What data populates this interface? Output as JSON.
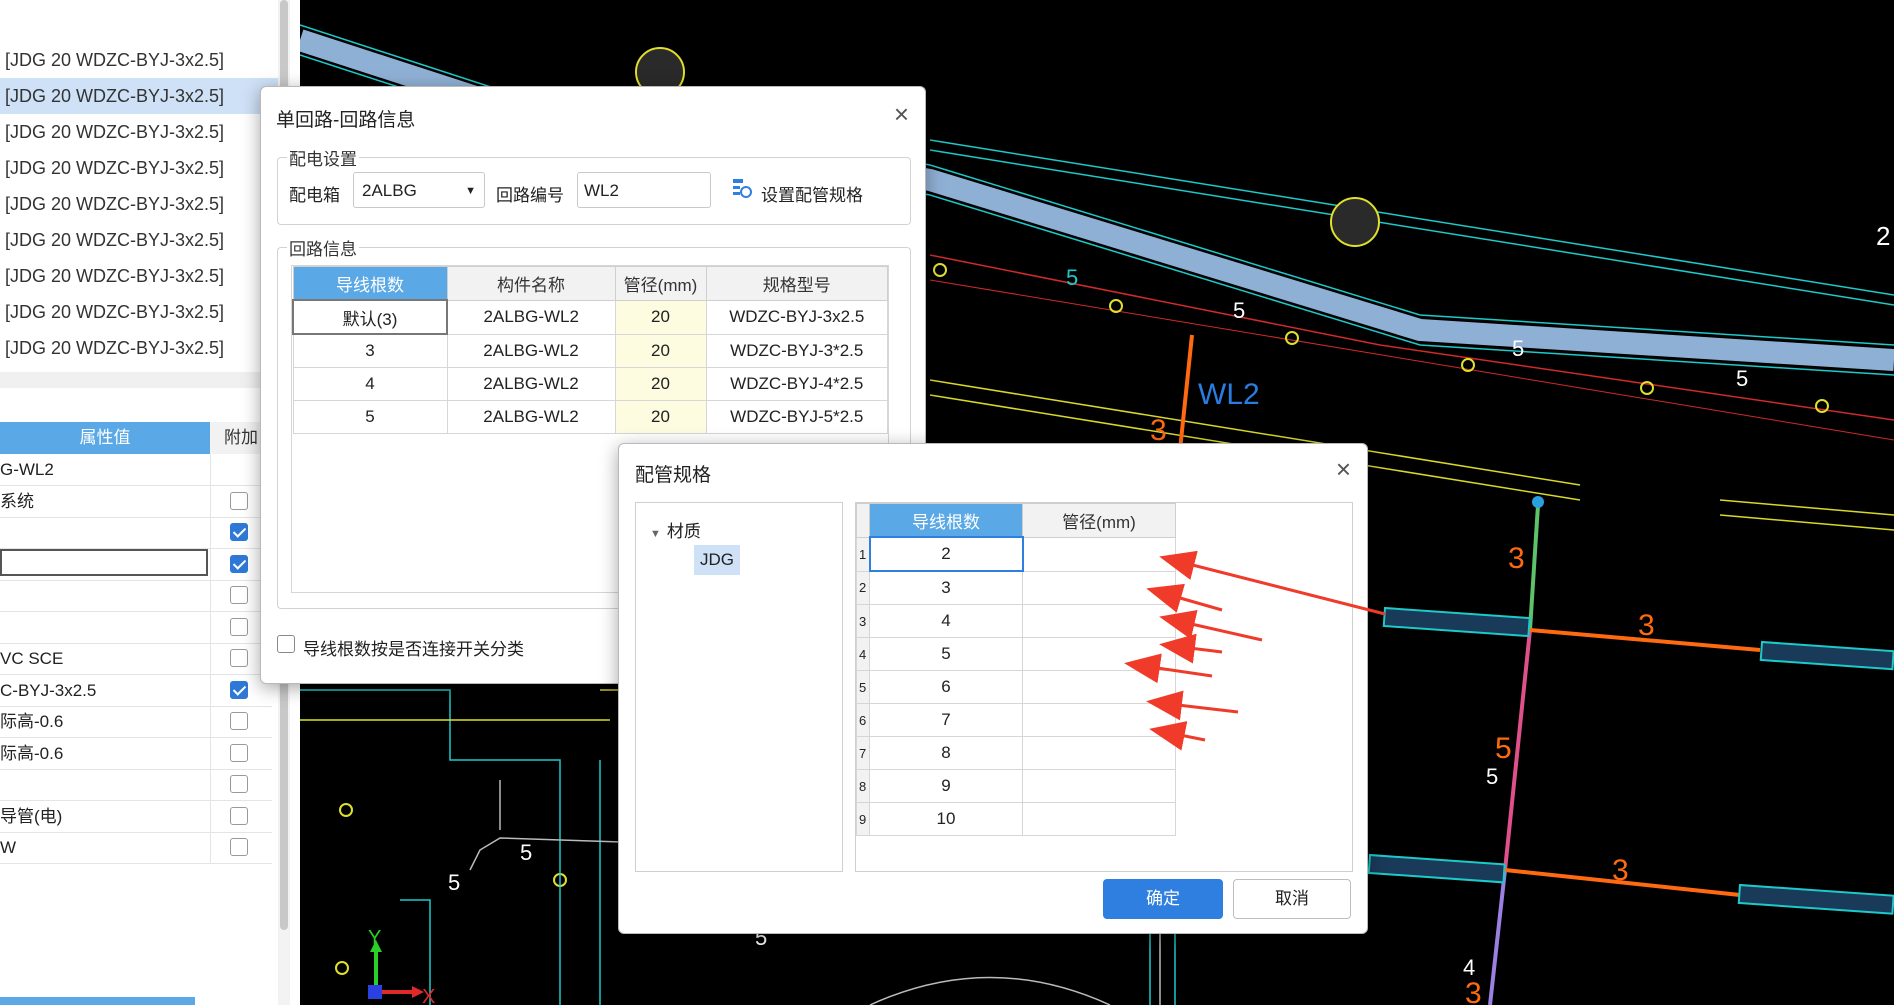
{
  "left_list": {
    "items": [
      "[JDG 20 WDZC-BYJ-3x2.5]",
      "[JDG 20 WDZC-BYJ-3x2.5]",
      "[JDG 20 WDZC-BYJ-3x2.5]",
      "[JDG 20 WDZC-BYJ-3x2.5]",
      "[JDG 20 WDZC-BYJ-3x2.5]",
      "[JDG 20 WDZC-BYJ-3x2.5]",
      "[JDG 20 WDZC-BYJ-3x2.5]",
      "[JDG 20 WDZC-BYJ-3x2.5]",
      "[JDG 20 WDZC-BYJ-3x2.5]"
    ],
    "selected_index": 1
  },
  "props": {
    "header_value": "属性值",
    "header_extra": "附加",
    "rows": [
      {
        "value": "G-WL2",
        "check": null
      },
      {
        "value": "系统",
        "check": false
      },
      {
        "value": "",
        "check": true
      },
      {
        "value": "",
        "check": true
      },
      {
        "value": "",
        "check": false
      },
      {
        "value": "",
        "check": false
      },
      {
        "value": "VC SCE",
        "check": false
      },
      {
        "value": "C-BYJ-3x2.5",
        "check": true
      },
      {
        "value": "际高-0.6",
        "check": false
      },
      {
        "value": "际高-0.6",
        "check": false
      },
      {
        "value": "",
        "check": false
      },
      {
        "value": "导管(电)",
        "check": false
      },
      {
        "value": "W",
        "check": false
      }
    ]
  },
  "circuit_dialog": {
    "title": "单回路-回路信息",
    "close": "×",
    "distribution_group": "配电设置",
    "box_label": "配电箱",
    "box_value": "2ALBG",
    "circuit_no_label": "回路编号",
    "circuit_no_value": "WL2",
    "set_spec_label": "设置配管规格",
    "circuit_group": "回路信息",
    "columns": [
      "导线根数",
      "构件名称",
      "管径(mm)",
      "规格型号"
    ],
    "rows": [
      [
        "默认(3)",
        "2ALBG-WL2",
        "20",
        "WDZC-BYJ-3x2.5"
      ],
      [
        "3",
        "2ALBG-WL2",
        "20",
        "WDZC-BYJ-3*2.5"
      ],
      [
        "4",
        "2ALBG-WL2",
        "20",
        "WDZC-BYJ-4*2.5"
      ],
      [
        "5",
        "2ALBG-WL2",
        "20",
        "WDZC-BYJ-5*2.5"
      ]
    ],
    "classify_checkbox": "导线根数按是否连接开关分类"
  },
  "spec_dialog": {
    "title": "配管规格",
    "close": "×",
    "tree_root": "材质",
    "tree_child": "JDG",
    "columns": [
      "导线根数",
      "管径(mm)"
    ],
    "row_numbers": [
      "1",
      "2",
      "3",
      "4",
      "5",
      "6",
      "7",
      "8",
      "9"
    ],
    "rows": [
      [
        "2",
        ""
      ],
      [
        "3",
        ""
      ],
      [
        "4",
        ""
      ],
      [
        "5",
        ""
      ],
      [
        "6",
        ""
      ],
      [
        "7",
        ""
      ],
      [
        "8",
        ""
      ],
      [
        "9",
        ""
      ],
      [
        "10",
        ""
      ]
    ],
    "ok_label": "确定",
    "cancel_label": "取消"
  },
  "cad": {
    "labels": [
      "WL2",
      "3",
      "3",
      "3",
      "5",
      "3",
      "5",
      "5",
      "5",
      "5",
      "5",
      "5",
      "4",
      "3",
      "2",
      "5",
      "5"
    ],
    "axis_x": "X",
    "axis_y": "Y"
  },
  "colors": {
    "accent": "#2f7fe0",
    "header_blue": "#5aa9e6",
    "annotation_red": "#f03a2a"
  }
}
